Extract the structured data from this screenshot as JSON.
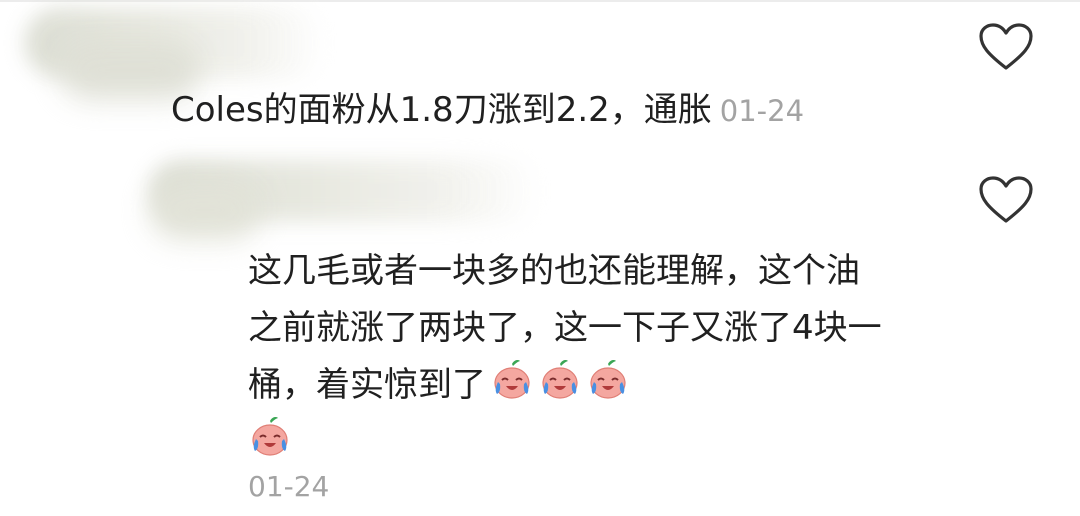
{
  "comments": [
    {
      "text": "Coles的面粉从1.8刀涨到2.2，通胀",
      "date": "01-24",
      "like_icon": "heart-outline-icon"
    },
    {
      "text": "这几毛或者一块多的也还能理解，这个油之前就涨了两块了，这一下子又涨了4块一桶，着实惊到了",
      "emojis": [
        "crying-face-emoji",
        "crying-face-emoji",
        "crying-face-emoji",
        "crying-face-emoji"
      ],
      "date": "01-24",
      "like_icon": "heart-outline-icon"
    }
  ],
  "colors": {
    "text": "#202020",
    "date": "#a3a3a3",
    "heart_stroke": "#333333",
    "emoji_face": "#f4a7a0",
    "emoji_tear": "#4a90e2"
  }
}
